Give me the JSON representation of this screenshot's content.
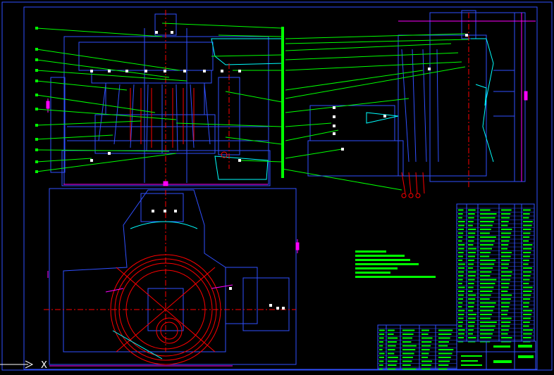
{
  "drawing": {
    "background": "#000000",
    "colors": {
      "frame": "#0000ff",
      "geometry": "#3050ff",
      "leader": "#00ff00",
      "dimension": "#ff00ff",
      "highlight": "#ff0000",
      "annotation": "#ffffff",
      "cyan": "#00ffff",
      "yellow": "#ffff00"
    }
  },
  "ucs": {
    "axis_x_label": "X"
  }
}
